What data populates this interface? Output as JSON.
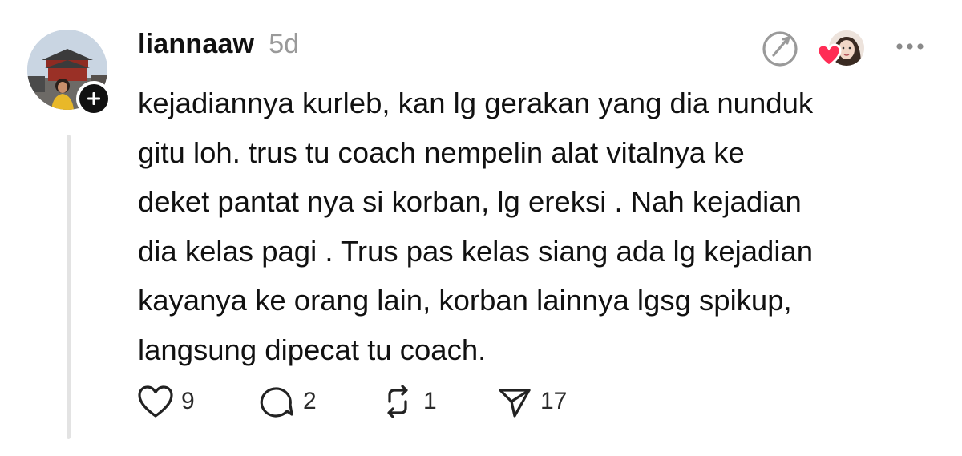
{
  "post": {
    "username": "liannaaw",
    "time": "5d",
    "body_lines": [
      "kejadiannya kurleb, kan lg gerakan yang dia nunduk",
      "gitu loh. trus tu coach nempelin alat vitalnya ke",
      "deket pantat nya si korban, lg ereksi . Nah kejadian",
      "dia kelas pagi . Trus pas kelas siang ada lg kejadian",
      "kayanya ke orang lain, korban lainnya lgsg spikup,",
      "langsung dipecat tu coach."
    ],
    "actions": {
      "likes": "9",
      "replies": "2",
      "reposts": "1",
      "shares": "17"
    }
  },
  "icons": {
    "header": [
      "translate-icon",
      "heart-icon",
      "more-icon"
    ],
    "actions": [
      "heart-icon",
      "reply-icon",
      "repost-icon",
      "send-icon"
    ],
    "badge": "plus-icon"
  },
  "colors": {
    "text": "#111111",
    "secondary_text": "#9a9a9a",
    "heart_red": "#ff2d55",
    "thread_line": "#e3e3e3"
  }
}
